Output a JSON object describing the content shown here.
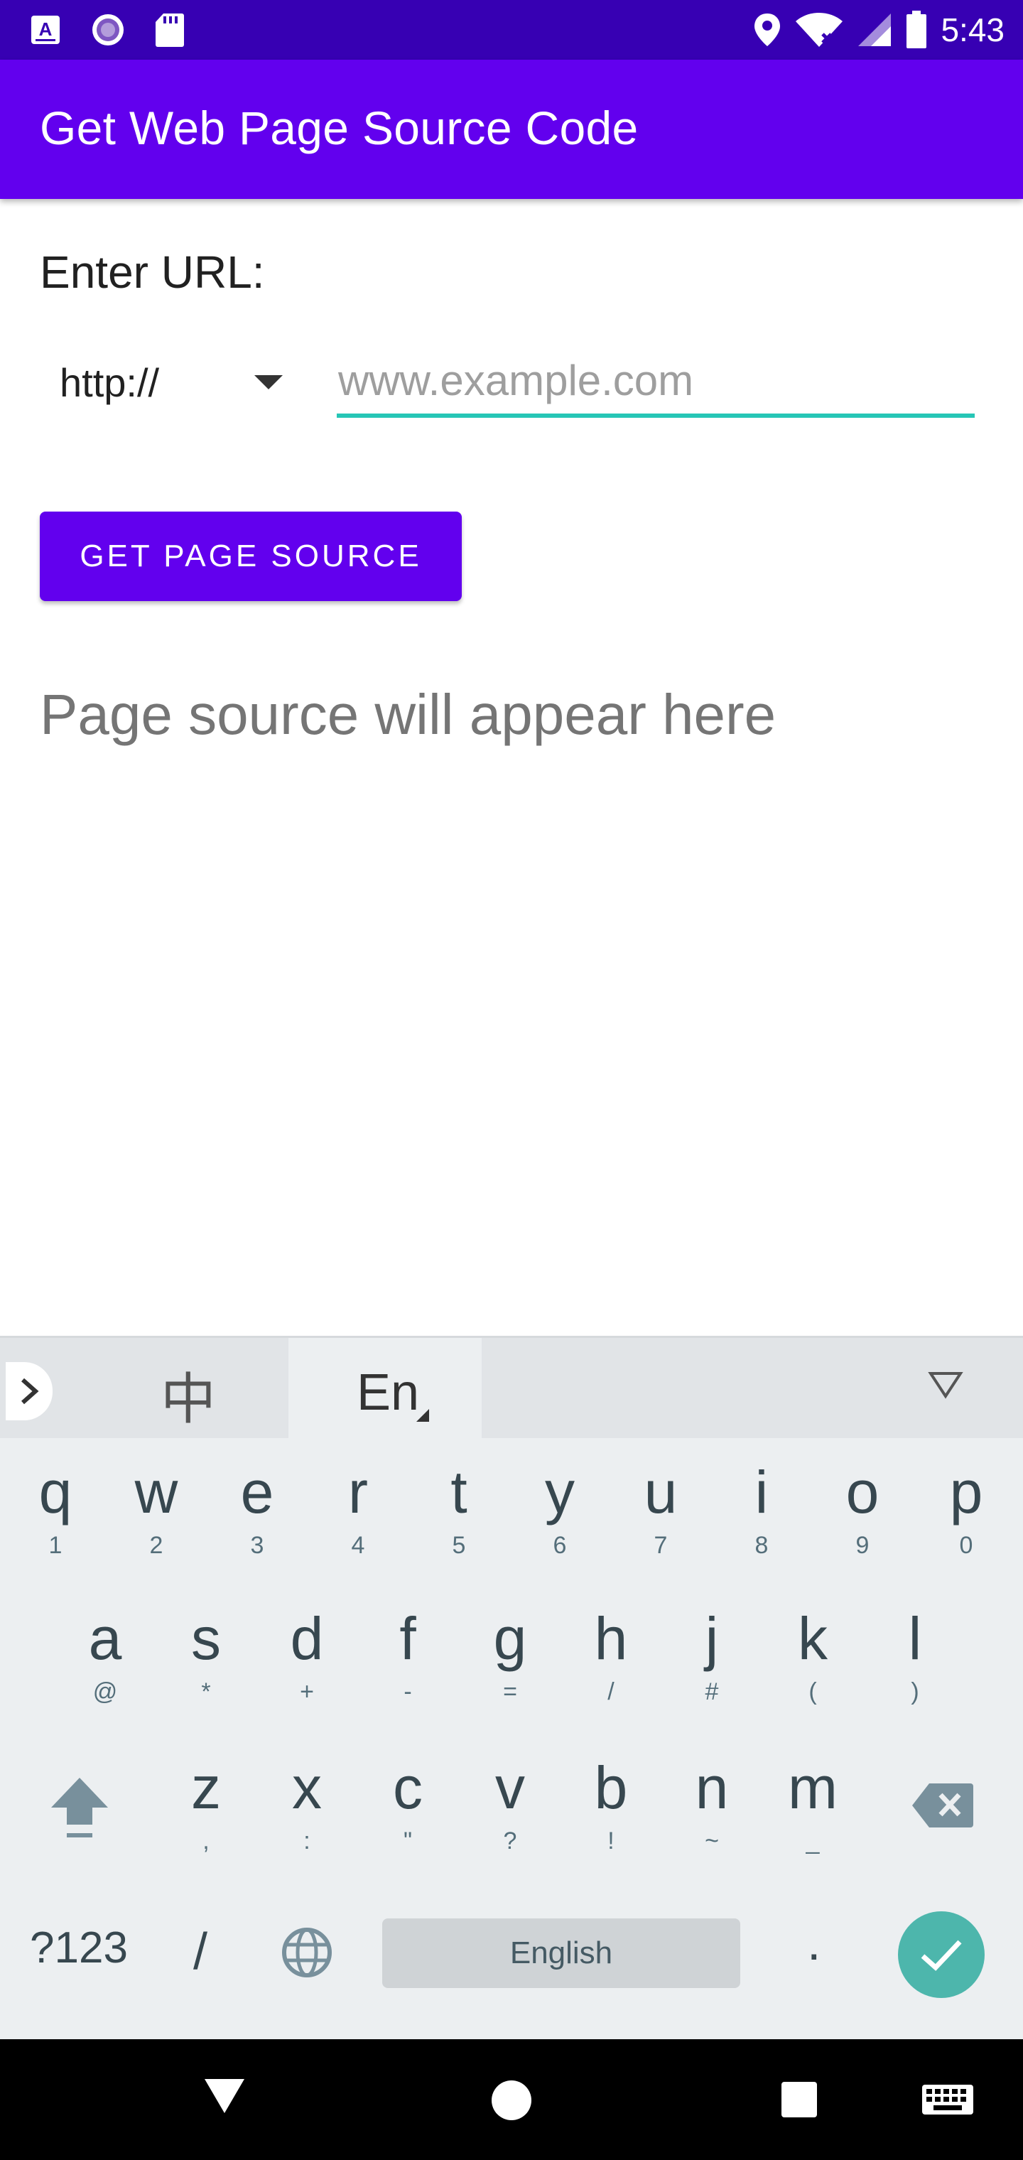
{
  "status_bar": {
    "time": "5:43",
    "left_icons": [
      "app-notification-icon",
      "circle-notification-icon",
      "sd-card-icon"
    ],
    "right_icons": [
      "location-icon",
      "wifi-icon",
      "signal-icon",
      "battery-icon"
    ]
  },
  "app_bar": {
    "title": "Get Web Page Source Code"
  },
  "form": {
    "label": "Enter URL:",
    "protocol": {
      "selected": "http://"
    },
    "url": {
      "value": "",
      "placeholder": "www.example.com"
    },
    "button_label": "GET PAGE SOURCE",
    "result_text": "Page source will appear here"
  },
  "keyboard": {
    "toolbar": {
      "chinese_label": "中",
      "english_label": "En"
    },
    "rows": [
      [
        {
          "k": "q",
          "s": "1"
        },
        {
          "k": "w",
          "s": "2"
        },
        {
          "k": "e",
          "s": "3"
        },
        {
          "k": "r",
          "s": "4"
        },
        {
          "k": "t",
          "s": "5"
        },
        {
          "k": "y",
          "s": "6"
        },
        {
          "k": "u",
          "s": "7"
        },
        {
          "k": "i",
          "s": "8"
        },
        {
          "k": "o",
          "s": "9"
        },
        {
          "k": "p",
          "s": "0"
        }
      ],
      [
        {
          "k": "a",
          "s": "@"
        },
        {
          "k": "s",
          "s": "*"
        },
        {
          "k": "d",
          "s": "+"
        },
        {
          "k": "f",
          "s": "-"
        },
        {
          "k": "g",
          "s": "="
        },
        {
          "k": "h",
          "s": "/"
        },
        {
          "k": "j",
          "s": "#"
        },
        {
          "k": "k",
          "s": "("
        },
        {
          "k": "l",
          "s": ")"
        }
      ],
      [
        {
          "k": "z",
          "s": ","
        },
        {
          "k": "x",
          "s": ":"
        },
        {
          "k": "c",
          "s": "\""
        },
        {
          "k": "v",
          "s": "?"
        },
        {
          "k": "b",
          "s": "!"
        },
        {
          "k": "n",
          "s": "~"
        },
        {
          "k": "m",
          "s": "_"
        }
      ]
    ],
    "symbols_label": "?123",
    "slash_label": "/",
    "space_label": "English",
    "period_label": "."
  },
  "colors": {
    "status_bar": "#3700b3",
    "primary": "#6200ee",
    "accent": "#26c6b6",
    "keyboard_done": "#4db6ac"
  }
}
